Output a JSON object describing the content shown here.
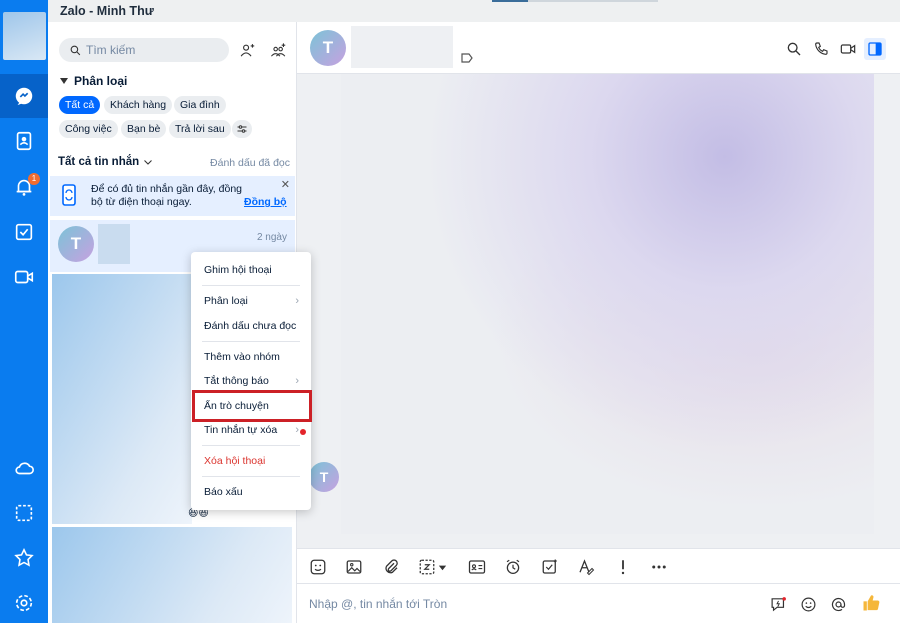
{
  "window": {
    "title": "Zalo - Minh Thư"
  },
  "nav": {
    "notification_badge": "1"
  },
  "list": {
    "search_placeholder": "Tìm kiếm",
    "classify_label": "Phân loại",
    "chips": [
      "Tất cả",
      "Khách hàng",
      "Gia đình",
      "Công việc",
      "Bạn bè",
      "Trả lời sau"
    ],
    "filter_label": "Tất cả tin nhắn",
    "mark_read": "Đánh dấu đã đọc",
    "sync": {
      "message": "Để có đủ tin nhắn gần đây, đồng bộ từ điện thoại ngay.",
      "link": "Đồng bộ",
      "close": "✕"
    },
    "conversation": {
      "avatar_letter": "T",
      "time": "2 ngày"
    },
    "emoji_tail": "😆😆"
  },
  "chat": {
    "avatar_letter": "T",
    "composer_placeholder": "Nhập @, tin nhắn tới Tròn"
  },
  "context_menu": {
    "items": [
      {
        "label": "Ghim hội thoại"
      },
      {
        "label": "Phân loại",
        "arrow": "›"
      },
      {
        "label": "Đánh dấu chưa đọc"
      },
      {
        "label": "Thêm vào nhóm"
      },
      {
        "label": "Tắt thông báo",
        "arrow": "›"
      },
      {
        "label": "Ẩn trò chuyện"
      },
      {
        "label": "Tin nhắn tự xóa",
        "arrow": "›"
      },
      {
        "label": "Xóa hội thoại"
      },
      {
        "label": "Báo xấu"
      }
    ]
  },
  "colors": {
    "nav_bg": "#0a7cef",
    "accent": "#0068ff",
    "danger": "#db342e",
    "highlight_border": "#cc2026"
  }
}
